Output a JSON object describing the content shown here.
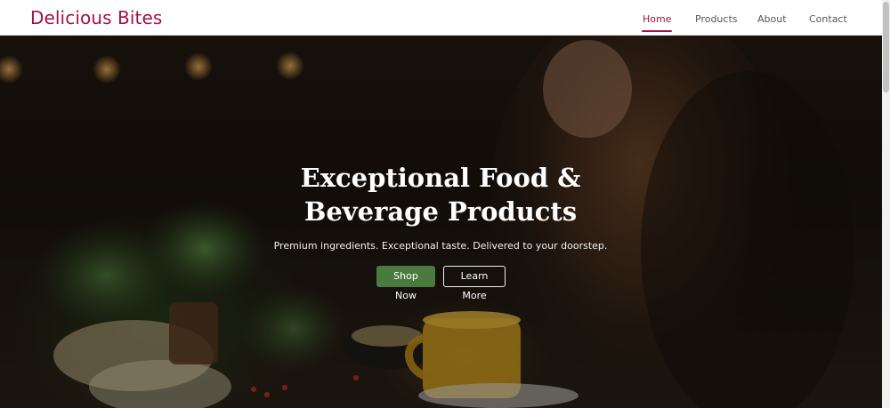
{
  "header": {
    "brand": "Delicious Bites",
    "nav": [
      {
        "label": "Home",
        "active": true
      },
      {
        "label": "Products",
        "active": false
      },
      {
        "label": "About",
        "active": false
      },
      {
        "label": "Contact",
        "active": false
      }
    ]
  },
  "hero": {
    "title": "Exceptional Food & Beverage Products",
    "subtitle": "Premium ingredients. Exceptional taste. Delivered to your doorstep.",
    "primary_button": "Shop Now",
    "secondary_button": "Learn More"
  },
  "colors": {
    "brand": "#a3133f",
    "primary_button": "#4a7a40",
    "nav_text": "#555555"
  }
}
